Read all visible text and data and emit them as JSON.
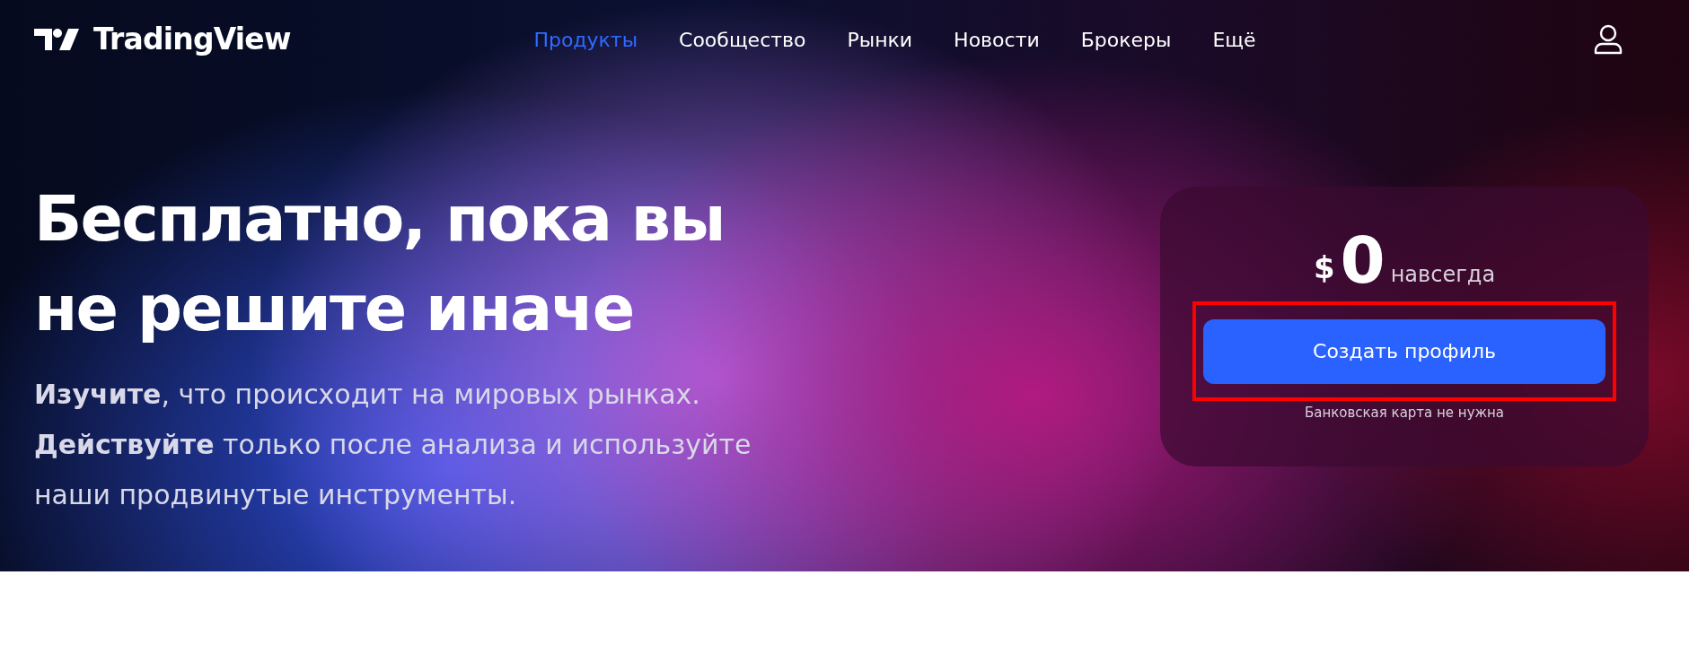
{
  "header": {
    "logo_text": "TradingView",
    "nav": [
      {
        "label": "Продукты",
        "selected": true
      },
      {
        "label": "Сообщество",
        "selected": false
      },
      {
        "label": "Рынки",
        "selected": false
      },
      {
        "label": "Новости",
        "selected": false
      },
      {
        "label": "Брокеры",
        "selected": false
      },
      {
        "label": "Ещё",
        "selected": false
      }
    ]
  },
  "hero": {
    "title_lines": [
      "Бесплатно, пока вы",
      "не решите иначе"
    ],
    "description_lines": [
      "**Изучите**, что происходит на мировых рынках.",
      "**Действуйте** только после анализа и используйте",
      "наши продвинутые инструменты."
    ]
  },
  "pricing_card": {
    "currency": "$",
    "price": "0",
    "period": "навсегда",
    "button": {
      "label": "Создать профиль",
      "highlighted": true
    },
    "note": "Банковская карта не нужна"
  }
}
